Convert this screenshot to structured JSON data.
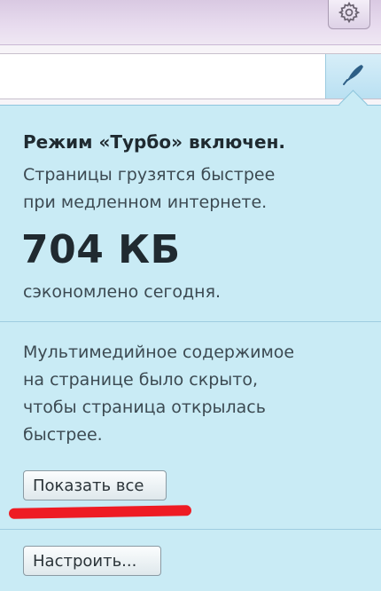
{
  "toolbar": {
    "settings_icon": "gear-icon",
    "turbo_icon": "rocket-icon"
  },
  "turbo_popup": {
    "title": "Режим «Турбо» включен.",
    "description_line1": "Страницы грузятся быстрее",
    "description_line2": "при медленном интернете.",
    "saved_amount": "704 КБ",
    "saved_caption": "сэкономлено сегодня.",
    "media_line1": "Мультимедийное содержимое",
    "media_line2": "на странице было скрыто,",
    "media_line3": "чтобы страница открылась",
    "media_line4": "быстрее.",
    "show_all_label": "Показать все",
    "configure_label": "Настроить..."
  },
  "colors": {
    "panel_background": "#c9ebf5",
    "annotation_underline": "#ee1c24"
  }
}
